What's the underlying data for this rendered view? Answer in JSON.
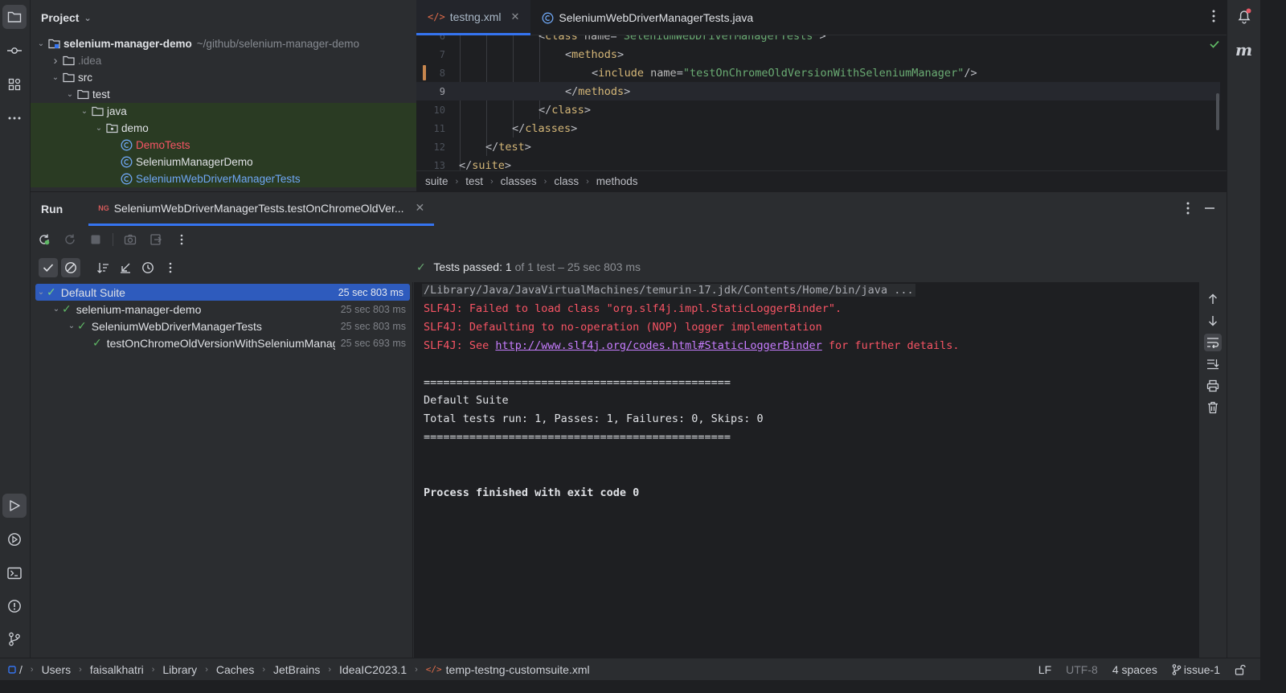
{
  "project_panel": {
    "title": "Project",
    "tree": [
      {
        "label": "selenium-manager-demo",
        "note": "~/github/selenium-manager-demo",
        "depth": 0,
        "kind": "module",
        "expanded": true
      },
      {
        "label": ".idea",
        "depth": 1,
        "kind": "folder",
        "expanded": false,
        "muted": true
      },
      {
        "label": "src",
        "depth": 1,
        "kind": "folder",
        "expanded": true
      },
      {
        "label": "test",
        "depth": 2,
        "kind": "folder",
        "expanded": true
      },
      {
        "label": "java",
        "depth": 3,
        "kind": "folder",
        "expanded": true,
        "selected": true
      },
      {
        "label": "demo",
        "depth": 4,
        "kind": "package",
        "expanded": true,
        "selected": true
      },
      {
        "label": "DemoTests",
        "depth": 5,
        "kind": "class",
        "color": "red",
        "selected": true
      },
      {
        "label": "SeleniumManagerDemo",
        "depth": 5,
        "kind": "class",
        "selected": true
      },
      {
        "label": "SeleniumWebDriverManagerTests",
        "depth": 5,
        "kind": "class",
        "color": "blue",
        "selected": true
      }
    ]
  },
  "editor": {
    "tabs": [
      {
        "label": "testng.xml",
        "active": true,
        "icon": "xml-icon"
      },
      {
        "label": "SeleniumWebDriverManagerTests.java",
        "active": false,
        "icon": "class-icon"
      }
    ],
    "lines": [
      {
        "no": "6",
        "indent": 3,
        "parts": [
          [
            "p",
            "<"
          ],
          [
            "tg",
            "class "
          ],
          [
            "at",
            "name"
          ],
          [
            "p",
            "="
          ],
          [
            "av",
            "\"SeleniumWebDriverManagerTests\""
          ],
          [
            "p",
            ">"
          ]
        ]
      },
      {
        "no": "7",
        "indent": 4,
        "parts": [
          [
            "p",
            "<"
          ],
          [
            "tg",
            "methods"
          ],
          [
            "p",
            ">"
          ]
        ]
      },
      {
        "no": "8",
        "indent": 5,
        "parts": [
          [
            "p",
            "<"
          ],
          [
            "tg",
            "include "
          ],
          [
            "at",
            "name"
          ],
          [
            "p",
            "="
          ],
          [
            "av",
            "\"testOnChromeOldVersionWithSeleniumManager\""
          ],
          [
            "p",
            "/>"
          ]
        ]
      },
      {
        "no": "9",
        "indent": 4,
        "parts": [
          [
            "p",
            "</"
          ],
          [
            "tg",
            "methods"
          ],
          [
            "p",
            ">"
          ]
        ],
        "current": true
      },
      {
        "no": "10",
        "indent": 3,
        "parts": [
          [
            "p",
            "</"
          ],
          [
            "tg",
            "class"
          ],
          [
            "p",
            ">"
          ]
        ]
      },
      {
        "no": "11",
        "indent": 2,
        "parts": [
          [
            "p",
            "</"
          ],
          [
            "tg",
            "classes"
          ],
          [
            "p",
            ">"
          ]
        ]
      },
      {
        "no": "12",
        "indent": 1,
        "parts": [
          [
            "p",
            "</"
          ],
          [
            "tg",
            "test"
          ],
          [
            "p",
            ">"
          ]
        ]
      },
      {
        "no": "13",
        "indent": 0,
        "parts": [
          [
            "p",
            "</"
          ],
          [
            "tg",
            "suite"
          ],
          [
            "p",
            ">"
          ]
        ]
      }
    ],
    "breadcrumbs": [
      "suite",
      "test",
      "classes",
      "class",
      "methods"
    ]
  },
  "run_panel": {
    "title": "Run",
    "tab_label": "SeleniumWebDriverManagerTests.testOnChromeOldVer...",
    "status": {
      "prefix": "Tests passed:",
      "count": "1",
      "suffix": "of 1 test – 25 sec 803 ms"
    },
    "tests": [
      {
        "label": "Default Suite",
        "time": "25 sec 803 ms",
        "depth": 0,
        "selected": true
      },
      {
        "label": "selenium-manager-demo",
        "time": "25 sec 803 ms",
        "depth": 1
      },
      {
        "label": "SeleniumWebDriverManagerTests",
        "time": "25 sec 803 ms",
        "depth": 2
      },
      {
        "label": "testOnChromeOldVersionWithSeleniumManager",
        "time": "25 sec 693 ms",
        "depth": 3
      }
    ],
    "console": [
      {
        "kind": "path",
        "text": "/Library/Java/JavaVirtualMachines/temurin-17.jdk/Contents/Home/bin/java ..."
      },
      {
        "kind": "err",
        "text": "SLF4J: Failed to load class \"org.slf4j.impl.StaticLoggerBinder\"."
      },
      {
        "kind": "err",
        "text": "SLF4J: Defaulting to no-operation (NOP) logger implementation"
      },
      {
        "kind": "errlink",
        "pre": "SLF4J: See ",
        "link": "http://www.slf4j.org/codes.html#StaticLoggerBinder",
        "post": " for further details."
      },
      {
        "kind": "blank",
        "text": ""
      },
      {
        "kind": "norm",
        "text": "==============================================="
      },
      {
        "kind": "norm",
        "text": "Default Suite"
      },
      {
        "kind": "norm",
        "text": "Total tests run: 1, Passes: 1, Failures: 0, Skips: 0"
      },
      {
        "kind": "norm",
        "text": "==============================================="
      },
      {
        "kind": "blank",
        "text": ""
      },
      {
        "kind": "blank",
        "text": ""
      },
      {
        "kind": "bold",
        "text": "Process finished with exit code 0"
      }
    ]
  },
  "status_bar": {
    "breadcrumbs": [
      "Users",
      "faisalkhatri",
      "Library",
      "Caches",
      "JetBrains",
      "IdeaIC2023.1",
      "temp-testng-customsuite.xml"
    ],
    "root": "/",
    "line_ending": "LF",
    "encoding": "UTF-8",
    "indent": "4 spaces",
    "branch": "issue-1"
  },
  "colors": {
    "accent": "#3574f0",
    "pass": "#5fb865",
    "error": "#f75464",
    "selection": "#2e5bbd"
  }
}
